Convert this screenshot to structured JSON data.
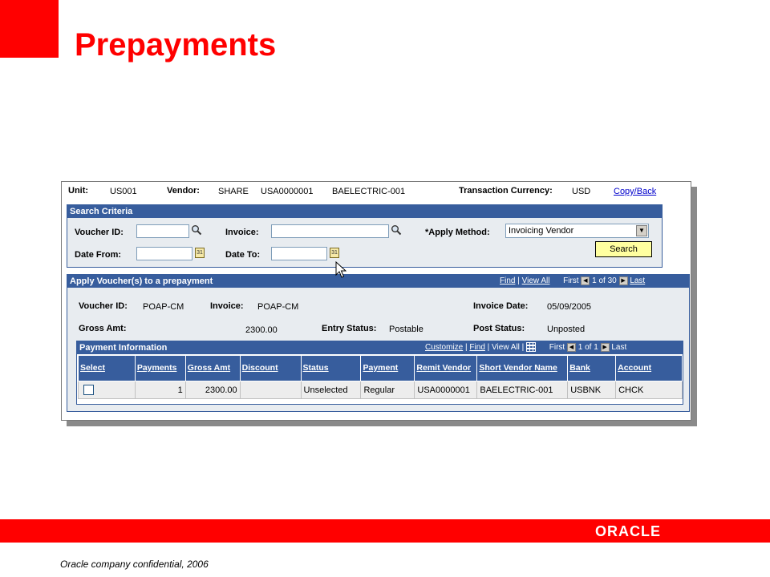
{
  "slide": {
    "title": "Prepayments",
    "footer": "Oracle company confidential, 2006",
    "logo": "ORACLE",
    "accent_color": "#ff0000"
  },
  "header": {
    "unit_label": "Unit:",
    "unit_value": "US001",
    "vendor_label": "Vendor:",
    "vendor_setid": "SHARE",
    "vendor_id": "USA0000001",
    "vendor_name": "BAELECTRIC-001",
    "currency_label": "Transaction Currency:",
    "currency_value": "USD",
    "copy_back_link": "Copy/Back"
  },
  "search_criteria": {
    "title": "Search Criteria",
    "voucher_id_label": "Voucher ID:",
    "voucher_id_value": "",
    "invoice_label": "Invoice:",
    "invoice_value": "",
    "apply_method_label": "*Apply Method:",
    "apply_method_value": "Invoicing Vendor",
    "date_from_label": "Date From:",
    "date_from_value": "",
    "date_to_label": "Date To:",
    "date_to_value": "",
    "search_button": "Search",
    "calendar_icon_text": "31"
  },
  "apply_section": {
    "title": "Apply Voucher(s) to a prepayment",
    "find_link": "Find",
    "view_all_link": "View All",
    "first_label": "First",
    "pager": "1 of 30",
    "last_link": "Last",
    "voucher_id_label": "Voucher ID:",
    "voucher_id_value": "POAP-CM",
    "invoice_label": "Invoice:",
    "invoice_value": "POAP-CM",
    "invoice_date_label": "Invoice Date:",
    "invoice_date_value": "05/09/2005",
    "gross_amt_label": "Gross Amt:",
    "gross_amt_value": "2300.00",
    "entry_status_label": "Entry Status:",
    "entry_status_value": "Postable",
    "post_status_label": "Post Status:",
    "post_status_value": "Unposted"
  },
  "payment_info": {
    "title": "Payment Information",
    "customize_link": "Customize",
    "find_link": "Find",
    "view_all": "View All",
    "first_label": "First",
    "pager": "1 of 1",
    "last_label": "Last",
    "columns": [
      "Select",
      "Payments",
      "Gross Amt",
      "Discount",
      "Status",
      "Payment",
      "Remit Vendor",
      "Short Vendor Name",
      "Bank",
      "Account"
    ],
    "rows": [
      {
        "select": false,
        "payments": "1",
        "gross_amt": "2300.00",
        "discount": "",
        "status": "Unselected",
        "payment": "Regular",
        "remit_vendor": "USA0000001",
        "short_vendor_name": "BAELECTRIC-001",
        "bank": "USBNK",
        "account": "CHCK"
      }
    ]
  }
}
